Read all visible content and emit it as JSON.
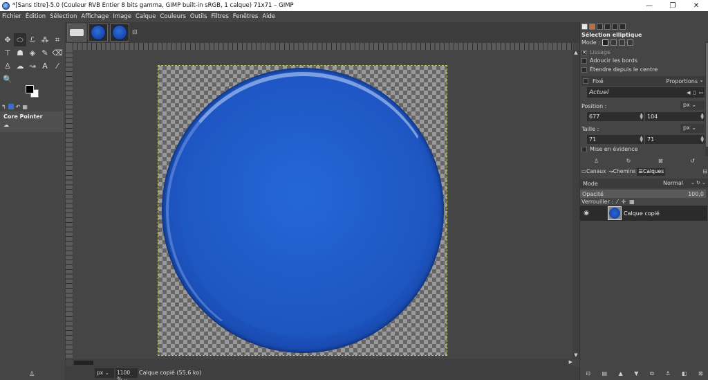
{
  "window": {
    "title": "*[Sans titre]-5.0 (Couleur RVB Entier 8 bits gamma, GIMP built-in sRGB, 1 calque) 71x71 – GIMP",
    "minimize": "—",
    "maximize": "❐",
    "close": "✕"
  },
  "menu": [
    "Fichier",
    "Édition",
    "Sélection",
    "Affichage",
    "Image",
    "Calque",
    "Couleurs",
    "Outils",
    "Filtres",
    "Fenêtres",
    "Aide"
  ],
  "toolbox": {
    "tools": [
      {
        "icon": "move-icon",
        "glyph": "✥"
      },
      {
        "icon": "ellipse-select-icon",
        "glyph": "⬭",
        "active": true
      },
      {
        "icon": "free-select-icon",
        "glyph": "ℒ"
      },
      {
        "icon": "fuzzy-select-icon",
        "glyph": "⁂"
      },
      {
        "icon": "crop-icon",
        "glyph": "⌗"
      },
      {
        "icon": "unified-transform-icon",
        "glyph": "⊤"
      },
      {
        "icon": "warp-transform-icon",
        "glyph": "☗"
      },
      {
        "icon": "bucket-fill-icon",
        "glyph": "◈"
      },
      {
        "icon": "paintbrush-icon",
        "glyph": "✎"
      },
      {
        "icon": "eraser-icon",
        "glyph": "⌫"
      },
      {
        "icon": "clone-icon",
        "glyph": "♙"
      },
      {
        "icon": "smudge-icon",
        "glyph": "☁"
      },
      {
        "icon": "paths-icon",
        "glyph": "↝"
      },
      {
        "icon": "text-icon",
        "glyph": "A"
      },
      {
        "icon": "color-picker-icon",
        "glyph": "⁄"
      },
      {
        "icon": "zoom-icon",
        "glyph": "🔍"
      }
    ],
    "device_status_label": "Core Pointer",
    "device_status_sub": "☁"
  },
  "image_tabs": [
    {
      "kind": "camera"
    },
    {
      "kind": "disc"
    },
    {
      "kind": "disc"
    }
  ],
  "tool_options": {
    "title": "Sélection elliptique",
    "mode_label": "Mode :",
    "antialias_label": "Lissage",
    "feather_label": "Adoucir les bords",
    "expand_center_label": "Étendre depuis le centre",
    "fixed_label": "Fixé",
    "fixed_value": "Proportions",
    "preset_value": "Actuel",
    "position_label": "Position :",
    "position_unit": "px",
    "position_x": "677",
    "position_y": "104",
    "size_label": "Taille :",
    "size_unit": "px",
    "size_w": "71",
    "size_h": "71",
    "highlight_label": "Mise en évidence"
  },
  "layers_panel": {
    "tabs": [
      "Canaux",
      "Chemins",
      "Calques"
    ],
    "mode_label": "Mode",
    "mode_value": "Normal",
    "opacity_label": "Opacité",
    "opacity_value": "100,0",
    "lock_label": "Verrouiller :",
    "layers": [
      {
        "name": "Calque copié",
        "visible": true
      }
    ]
  },
  "statusbar": {
    "unit": "px",
    "zoom": "1100 %",
    "message": "Calque copié (55,6 ko)"
  },
  "colors": {
    "fg": "#000000",
    "bg": "#ffffff",
    "disc_blue": "#1f58c6"
  }
}
